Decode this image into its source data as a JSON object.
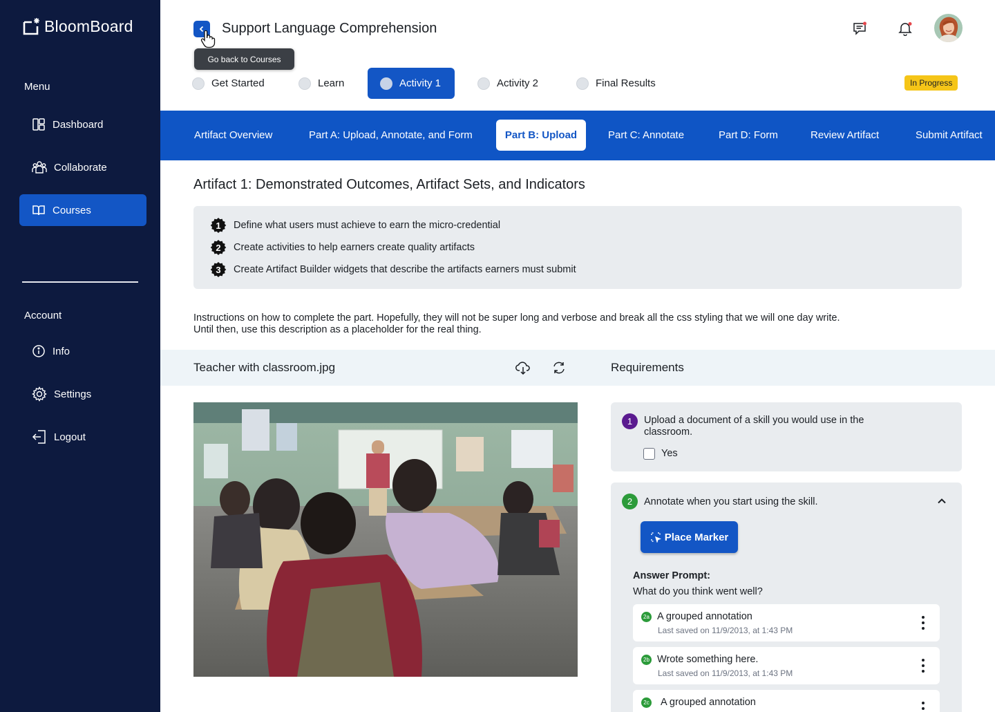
{
  "app": {
    "name": "BloomBoard"
  },
  "sidebar": {
    "menu_heading": "Menu",
    "menu_items": [
      {
        "label": "Dashboard",
        "icon": "dashboard-icon"
      },
      {
        "label": "Collaborate",
        "icon": "collaborate-icon"
      },
      {
        "label": "Courses",
        "icon": "book-icon",
        "active": true
      }
    ],
    "account_heading": "Account",
    "account_items": [
      {
        "label": "Info",
        "icon": "info-icon"
      },
      {
        "label": "Settings",
        "icon": "gear-icon"
      },
      {
        "label": "Logout",
        "icon": "logout-icon"
      }
    ]
  },
  "header": {
    "title": "Support Language Comprehension",
    "back_tooltip": "Go back to Courses"
  },
  "steps": {
    "items": [
      "Get Started",
      "Learn",
      "Activity 1",
      "Activity 2",
      "Final Results"
    ],
    "active": "Activity 1",
    "status_badge": "In Progress"
  },
  "tabs": {
    "items": [
      "Artifact Overview",
      "Part A: Upload, Annotate, and Form",
      "Part B: Upload",
      "Part C: Annotate",
      "Part D: Form",
      "Review Artifact",
      "Submit Artifact"
    ],
    "active": "Part B: Upload"
  },
  "main": {
    "section_title": "Artifact 1: Demonstrated Outcomes, Artifact Sets, and Indicators",
    "outcomes": [
      {
        "number": "1",
        "text": "Define what users must achieve to earn the micro-credential"
      },
      {
        "number": "2",
        "text": "Create activities to help earners create quality artifacts"
      },
      {
        "number": "3",
        "text": "Create Artifact Builder widgets that describe the artifacts earners must submit"
      }
    ],
    "instructions": "Instructions on how to complete the part. Hopefully, they will not be super long and verbose and break all the css styling that we will one day write. Until then, use this description as a placeholder for the real thing.",
    "file_name": "Teacher with classroom.jpg",
    "requirements_title": "Requirements"
  },
  "requirements": {
    "req1": {
      "number": "1",
      "text": "Upload a document of a skill you would use in the classroom.",
      "checkbox_label": "Yes",
      "checked": false
    },
    "req2": {
      "number": "2",
      "text": "Annotate when you start using the skill.",
      "button_label": "Place Marker",
      "answer_prompt_label": "Answer Prompt:",
      "answer_prompt_text": "What do you think went well?",
      "annotations": [
        {
          "badge": "2a",
          "title": "A grouped annotation",
          "saved": "Last saved on 11/9/2013, at 1:43 PM"
        },
        {
          "badge": "2b",
          "title": "Wrote something here.",
          "saved": "Last saved on 11/9/2013, at 1:43 PM"
        },
        {
          "badge": "2c",
          "title": "A grouped annotation",
          "saved": ""
        }
      ]
    }
  },
  "colors": {
    "sidebar_bg": "#0d1a3f",
    "primary": "#1356c5",
    "badge_yellow": "#f5c518",
    "step_purple": "#5a1a8f",
    "step_green": "#2c9b3a"
  }
}
